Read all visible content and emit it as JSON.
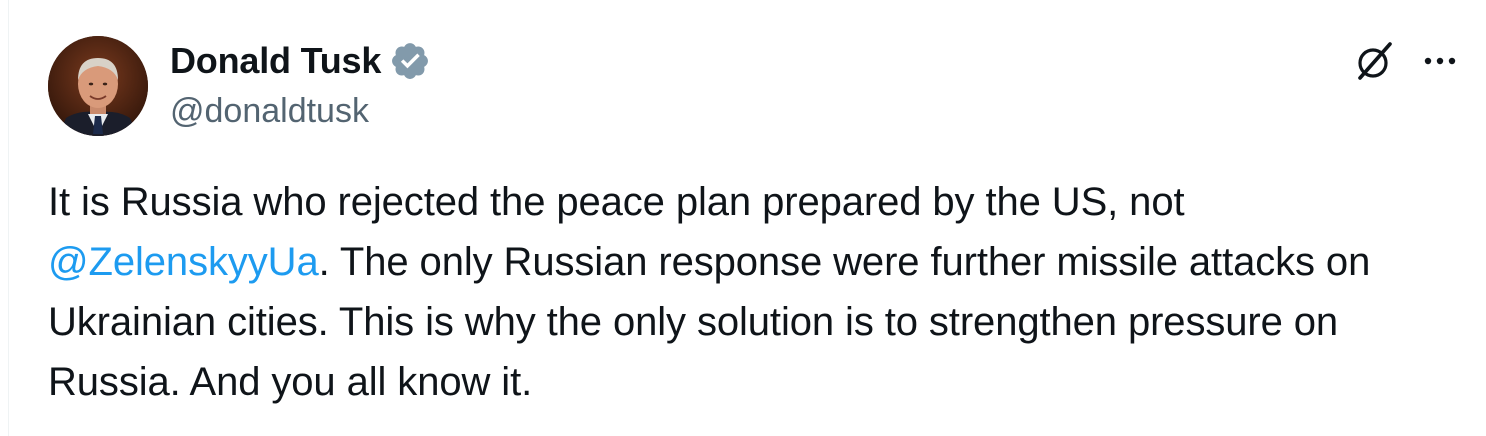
{
  "author": {
    "display_name": "Donald Tusk",
    "handle": "@donaldtusk",
    "verified": true,
    "avatar": "profile-photo"
  },
  "tweet": {
    "text_before_mention": "It is Russia who rejected the peace plan prepared by the US, not ",
    "mention": "@ZelenskyyUa",
    "text_after_mention": ". The only Russian response were further missile attacks on Ukrainian cities. This is why the only solution is to strengthen pressure on Russia. And you all know it."
  },
  "icons": {
    "verified": "verified-badge-icon",
    "grok": "grok-icon",
    "more": "more-options-icon"
  },
  "colors": {
    "text": "#0f1419",
    "secondary": "#536471",
    "link": "#1d9bf0",
    "verified": "#829aab"
  }
}
